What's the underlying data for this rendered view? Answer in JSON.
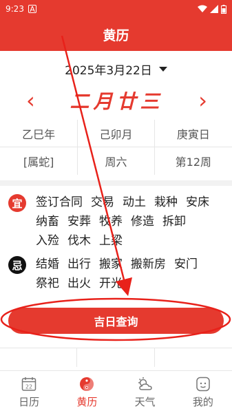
{
  "status": {
    "time": "9:23",
    "notification_icon": "A"
  },
  "header": {
    "title": "黄历"
  },
  "date": {
    "label": "2025年3月22日"
  },
  "lunar": {
    "day": "二月廿三"
  },
  "ganzhi": [
    "乙巳年",
    "己卯月",
    "庚寅日",
    "[属蛇]",
    "周六",
    "第12周"
  ],
  "yi": {
    "badge": "宜",
    "items": [
      "签订合同",
      "交易",
      "动土",
      "栽种",
      "安床",
      "纳畜",
      "安葬",
      "牧养",
      "修造",
      "拆卸",
      "入殓",
      "伐木",
      "上梁"
    ]
  },
  "ji": {
    "badge": "忌",
    "items": [
      "结婚",
      "出行",
      "搬家",
      "搬新房",
      "安门",
      "祭祀",
      "出火",
      "开光"
    ]
  },
  "query_button": {
    "label": "吉日查询"
  },
  "tabs": [
    {
      "label": "日历",
      "icon": "calendar-icon",
      "day": "22"
    },
    {
      "label": "黄历",
      "icon": "yin-yang-icon"
    },
    {
      "label": "天气",
      "icon": "weather-icon"
    },
    {
      "label": "我的",
      "icon": "profile-icon"
    }
  ],
  "colors": {
    "accent": "#e53a2f"
  }
}
